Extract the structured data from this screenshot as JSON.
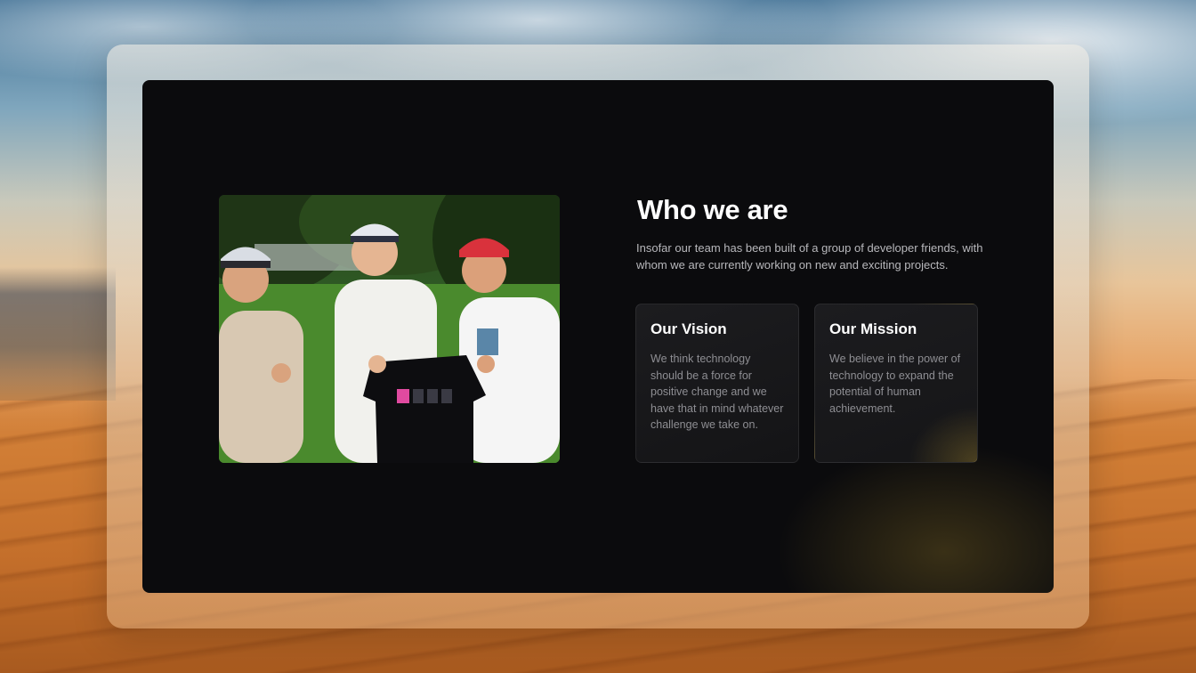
{
  "about": {
    "heading": "Who we are",
    "intro": "Insofar our team has been built of a group of developer friends, with whom we are currently working on new and exciting projects.",
    "photo_icon": "team-photo"
  },
  "cards": {
    "vision": {
      "title": "Our Vision",
      "text": "We think technology should be a force for positive change and we have that in mind whatever challenge we take on."
    },
    "mission": {
      "title": "Our Mission",
      "text": "We believe in the power of technology to expand the potential of human achievement."
    }
  },
  "colors": {
    "panel_bg": "#0b0b0d",
    "card_bg": "#1a1a1d",
    "heading": "#ffffff",
    "body_text": "#b8b8bc",
    "card_text": "#8e8e93"
  }
}
